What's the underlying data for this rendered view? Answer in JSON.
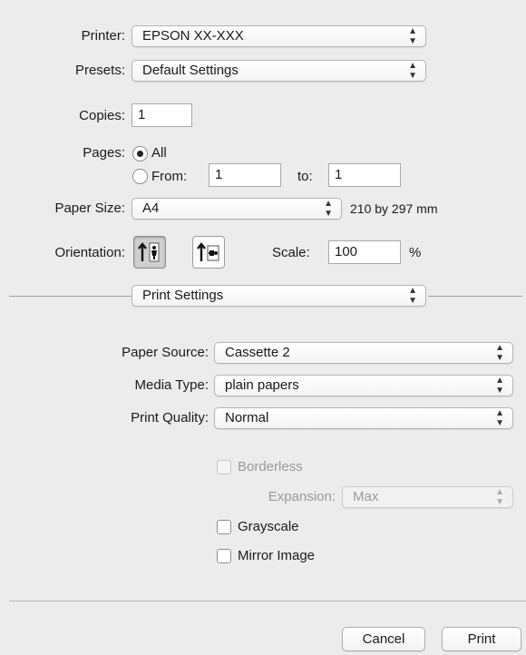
{
  "printer": {
    "label": "Printer:",
    "value": "EPSON  XX-XXX"
  },
  "presets": {
    "label": "Presets:",
    "value": "Default Settings"
  },
  "copies": {
    "label": "Copies:",
    "value": "1"
  },
  "pages": {
    "label": "Pages:",
    "all_label": "All",
    "from_label": "From:",
    "from_value": "1",
    "to_label": "to:",
    "to_value": "1",
    "selected": "All"
  },
  "paper_size": {
    "label": "Paper Size:",
    "value": "A4",
    "dimensions": "210 by 297 mm"
  },
  "orientation": {
    "label": "Orientation:",
    "selected": "portrait"
  },
  "scale": {
    "label": "Scale:",
    "value": "100",
    "unit": "%"
  },
  "section": {
    "value": "Print Settings"
  },
  "print_settings": {
    "paper_source": {
      "label": "Paper Source:",
      "value": "Cassette 2"
    },
    "media_type": {
      "label": "Media Type:",
      "value": "plain papers"
    },
    "print_quality": {
      "label": "Print Quality:",
      "value": "Normal"
    },
    "borderless": {
      "label": "Borderless",
      "checked": false,
      "enabled": false
    },
    "expansion": {
      "label": "Expansion:",
      "value": "Max",
      "enabled": false
    },
    "grayscale": {
      "label": "Grayscale",
      "checked": false
    },
    "mirror_image": {
      "label": "Mirror Image",
      "checked": false
    }
  },
  "buttons": {
    "cancel": "Cancel",
    "print": "Print"
  }
}
